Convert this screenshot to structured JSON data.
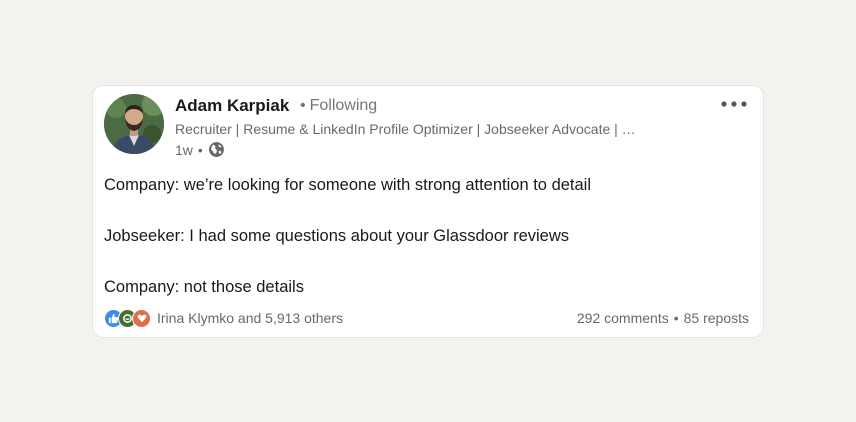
{
  "author": {
    "name": "Adam Karpiak",
    "follow_status": "Following",
    "headline": "Recruiter | Resume & LinkedIn Profile Optimizer | Jobseeker Advocate | …",
    "time": "1w",
    "visibility_icon": "globe-icon"
  },
  "menu_icon": "more-horizontal-icon",
  "post": {
    "lines": [
      "Company: we’re looking for someone with strong attention to detail",
      "Jobseeker: I had some questions about your Glassdoor reviews",
      "Company: not those details"
    ]
  },
  "social": {
    "reaction_icons": [
      "like-icon",
      "celebrate-icon",
      "love-icon"
    ],
    "reactions_text": "Irina Klymko and 5,913 others",
    "comments": "292 comments",
    "reposts": "85 reposts"
  },
  "colors": {
    "background": "#f3f2ef",
    "card": "#ffffff",
    "like": "#378fe9",
    "celebrate": "#44712e",
    "love": "#df704d"
  }
}
